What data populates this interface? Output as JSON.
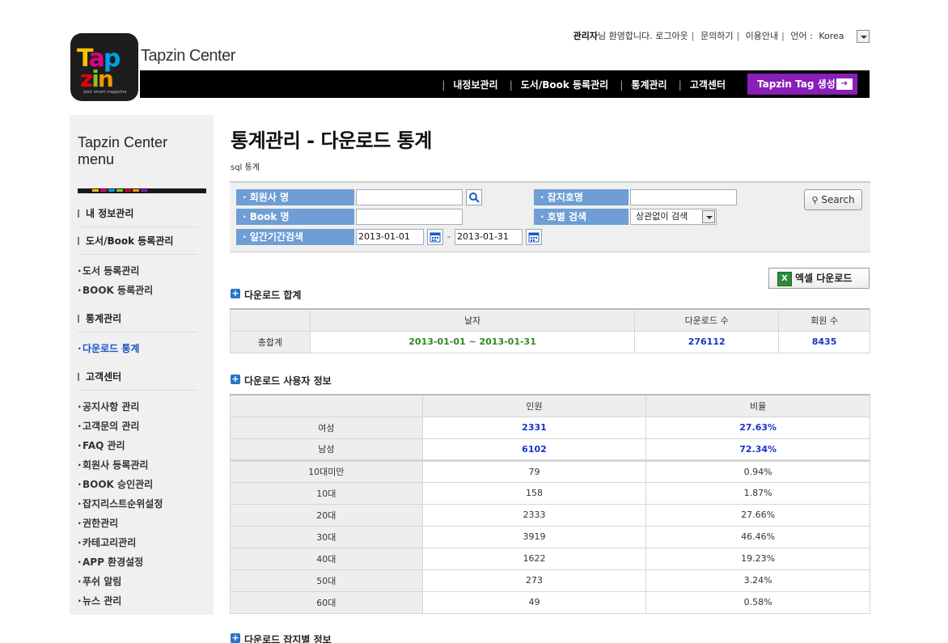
{
  "brand": {
    "logo_line1": "Tap",
    "logo_line2": "zin",
    "logo_tagline": "your smart magazine",
    "name": "Tapzin Center"
  },
  "topbar": {
    "user": "관리자",
    "greeting": "님 환영합니다.",
    "links": [
      "로그아웃",
      "문의하기",
      "이용안내"
    ],
    "lang_label": "언어 :",
    "lang_value": "Korea"
  },
  "nav": {
    "items": [
      "내정보관리",
      "도서/Book 등록관리",
      "통계관리",
      "고객센터"
    ],
    "tag_button": "Tapzin Tag 생성"
  },
  "sidebar": {
    "title_line1": "Tapzin Center",
    "title_line2": "menu",
    "sections": [
      {
        "label": "내 정보관리",
        "items": []
      },
      {
        "label": "도서/Book 등록관리",
        "items": [
          "도서 등록관리",
          "BOOK 등록관리"
        ]
      },
      {
        "label": "통계관리",
        "items": [
          "다운로드 통계"
        ]
      },
      {
        "label": "고객센터",
        "items": [
          "공지사항 관리",
          "고객문의 관리",
          "FAQ 관리",
          "회원사 등록관리",
          "BOOK 승인관리",
          "잡지리스트순위설정",
          "권한관리",
          "카테고리관리",
          "APP 환경설정",
          "푸쉬 알림",
          "뉴스 관리"
        ]
      }
    ],
    "active_item": "다운로드 통계"
  },
  "page": {
    "title": "통계관리 - 다운로드 통계",
    "subtitle": "sql 통계"
  },
  "search": {
    "company_label": "· 회원사 명",
    "company_value": "",
    "book_label": "· Book 명",
    "book_value": "",
    "period_label": "· 일간기간검색",
    "date_from": "2013-01-01",
    "date_sep": "-",
    "date_to": "2013-01-31",
    "magazine_label": "· 잡지호명",
    "magazine_value": "",
    "issue_label": "· 호별 검색",
    "issue_select": "상관없이 검색",
    "search_button": "Search"
  },
  "excel_button": "엑셀 다운로드",
  "summary": {
    "title": "다운로드 합계",
    "headers": [
      "",
      "날자",
      "다운로드 수",
      "회원 수"
    ],
    "row": {
      "label": "총합계",
      "period": "2013-01-01 ~ 2013-01-31",
      "downloads": "276112",
      "members": "8435"
    }
  },
  "users": {
    "title": "다운로드 사용자 정보",
    "headers": [
      "",
      "인원",
      "비율"
    ],
    "gender": [
      {
        "label": "여성",
        "count": "2331",
        "ratio": "27.63%"
      },
      {
        "label": "남성",
        "count": "6102",
        "ratio": "72.34%"
      }
    ],
    "ages": [
      {
        "label": "10대미만",
        "count": "79",
        "ratio": "0.94%"
      },
      {
        "label": "10대",
        "count": "158",
        "ratio": "1.87%"
      },
      {
        "label": "20대",
        "count": "2333",
        "ratio": "27.66%"
      },
      {
        "label": "30대",
        "count": "3919",
        "ratio": "46.46%"
      },
      {
        "label": "40대",
        "count": "1622",
        "ratio": "19.23%"
      },
      {
        "label": "50대",
        "count": "273",
        "ratio": "3.24%"
      },
      {
        "label": "60대",
        "count": "49",
        "ratio": "0.58%"
      }
    ]
  },
  "magazine_section": {
    "title": "다운로드 잡지별 정보"
  }
}
